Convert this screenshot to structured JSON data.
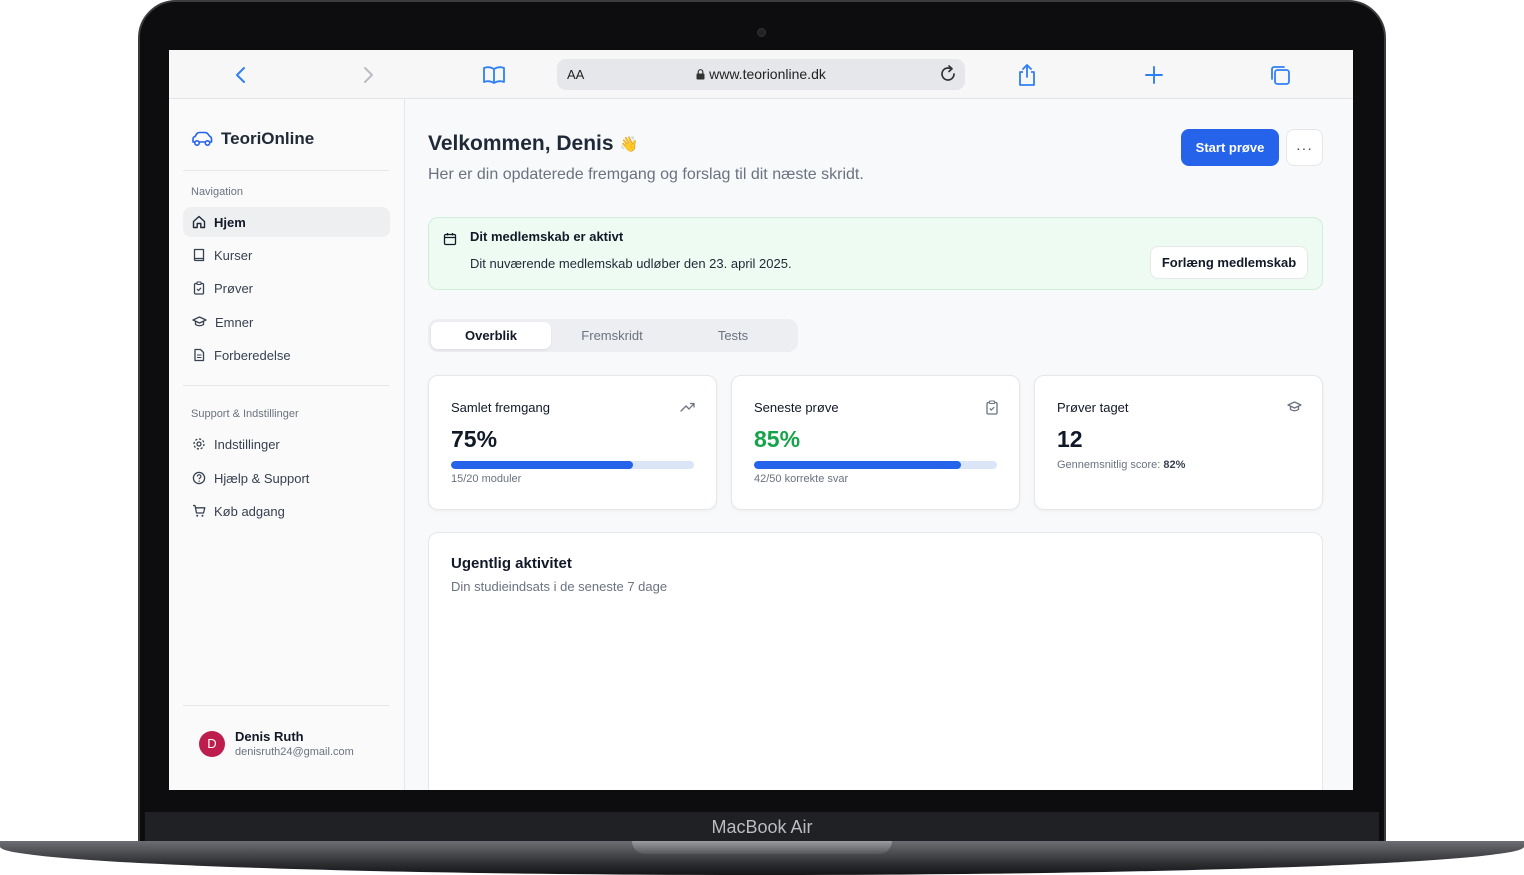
{
  "device": {
    "brand_label": "MacBook Air"
  },
  "browser": {
    "text_size_label": "AA",
    "url": "www.teorionline.dk"
  },
  "sidebar": {
    "app_name": "TeoriOnline",
    "nav_section_label": "Navigation",
    "nav_items": [
      {
        "label": "Hjem",
        "icon": "home-icon",
        "active": true
      },
      {
        "label": "Kurser",
        "icon": "book-icon"
      },
      {
        "label": "Prøver",
        "icon": "clipboard-icon"
      },
      {
        "label": "Emner",
        "icon": "graduation-cap-icon"
      },
      {
        "label": "Forberedelse",
        "icon": "document-icon"
      }
    ],
    "support_section_label": "Support & Indstillinger",
    "support_items": [
      {
        "label": "Indstillinger",
        "icon": "gear-icon"
      },
      {
        "label": "Hjælp & Support",
        "icon": "help-circle-icon"
      },
      {
        "label": "Køb adgang",
        "icon": "cart-icon"
      }
    ],
    "user": {
      "initial": "D",
      "name": "Denis Ruth",
      "email": "denisruth24@gmail.com"
    }
  },
  "header": {
    "title": "Velkommen, Denis",
    "emoji": "👋",
    "subtitle": "Her er din opdaterede fremgang og forslag til dit næste skridt.",
    "primary_button": "Start prøve",
    "more_button": "···"
  },
  "membership_alert": {
    "title": "Dit medlemskab er aktivt",
    "text": "Dit nuværende medlemskab udløber den 23. april 2025.",
    "button": "Forlæng medlemskab"
  },
  "tabs": [
    {
      "label": "Overblik",
      "active": true
    },
    {
      "label": "Fremskridt"
    },
    {
      "label": "Tests"
    }
  ],
  "stats": [
    {
      "title": "Samlet fremgang",
      "value": "75%",
      "progress": 0.75,
      "note": "15/20 moduler",
      "icon": "trending-up-icon"
    },
    {
      "title": "Seneste prøve",
      "value": "85%",
      "progress": 0.85,
      "note": "42/50 korrekte svar",
      "icon": "clipboard-check-icon",
      "value_color": "#16a34a"
    },
    {
      "title": "Prøver taget",
      "value": "12",
      "note_label": "Gennemsnitlig score:",
      "note_value": "82%",
      "icon": "graduation-cap-icon"
    }
  ],
  "activity": {
    "title": "Ugentlig aktivitet",
    "subtitle": "Din studieindsats i de seneste 7 dage"
  },
  "colors": {
    "primary": "#2563eb",
    "success": "#16a34a",
    "avatar": "#be1e4d",
    "alert_bg": "#eefbf2"
  }
}
